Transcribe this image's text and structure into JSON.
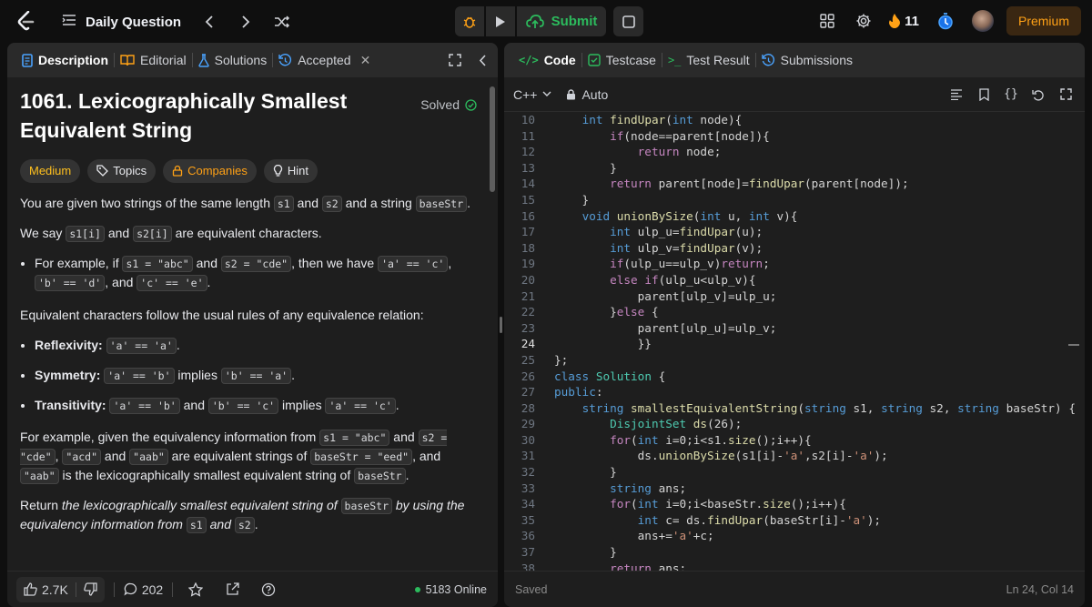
{
  "topbar": {
    "title": "Daily Question",
    "submit_label": "Submit",
    "streak": "11",
    "premium_label": "Premium"
  },
  "left_tabs": [
    "Description",
    "Editorial",
    "Solutions",
    "Accepted"
  ],
  "problem": {
    "title": "1061. Lexicographically Smallest Equivalent String",
    "solved_label": "Solved",
    "difficulty": "Medium",
    "chips": [
      "Topics",
      "Companies",
      "Hint"
    ],
    "p1a": "You are given two strings of the same length ",
    "p1_c1": "s1",
    "p1b": " and ",
    "p1_c2": "s2",
    "p1c": " and a string ",
    "p1_c3": "baseStr",
    "p1d": ".",
    "p2a": "We say ",
    "p2_c1": "s1[i]",
    "p2b": " and ",
    "p2_c2": "s2[i]",
    "p2c": " are equivalent characters.",
    "b1a": "For example, if ",
    "b1_c1": "s1 = \"abc\"",
    "b1b": " and ",
    "b1_c2": "s2 = \"cde\"",
    "b1c": ", then we have ",
    "b1_c3": "'a' == 'c'",
    "b1d": ",",
    "b1_c4": "'b' == 'd'",
    "b1e": ", and ",
    "b1_c5": "'c' == 'e'",
    "b1f": ".",
    "p3": "Equivalent characters follow the usual rules of any equivalence relation:",
    "r1_label": "Reflexivity:",
    "r1_c": "'a' == 'a'",
    "r1_end": ".",
    "r2_label": "Symmetry:",
    "r2_c1": "'a' == 'b'",
    "r2_mid": " implies ",
    "r2_c2": "'b' == 'a'",
    "r2_end": ".",
    "r3_label": "Transitivity:",
    "r3_c1": "'a' == 'b'",
    "r3_and": " and ",
    "r3_c2": "'b' == 'c'",
    "r3_mid": " implies ",
    "r3_c3": "'a' == 'c'",
    "r3_end": ".",
    "p4a": "For example, given the equivalency information from ",
    "p4_c1": "s1 = \"abc\"",
    "p4b": " and ",
    "p4_c2": "s2 = \"cde\"",
    "p4c": ", ",
    "p4_c3": "\"acd\"",
    "p4d": " and ",
    "p4_c4": "\"aab\"",
    "p4e": " are equivalent strings of ",
    "p4_c5": "baseStr = \"eed\"",
    "p4f": ", and ",
    "p4_c6": "\"aab\"",
    "p4g": " is the lexicographically smallest equivalent string of ",
    "p4_c7": "baseStr",
    "p4h": ".",
    "p5a": "Return ",
    "p5i": "the lexicographically smallest equivalent string of ",
    "p5_c1": "baseStr",
    "p5i2": " by using the equivalency information from ",
    "p5_c2": "s1",
    "p5i3": " and ",
    "p5_c3": "s2",
    "p5end": "."
  },
  "left_bottom": {
    "likes": "2.7K",
    "comments": "202",
    "online": "5183 Online"
  },
  "right_tabs": [
    "Code",
    "Testcase",
    "Test Result",
    "Submissions"
  ],
  "editor": {
    "language": "C++",
    "mode": "Auto",
    "status": "Saved",
    "cursor": "Ln 24, Col 14"
  },
  "code_lines": [
    {
      "n": "10",
      "t": "    int findUpar(int node){"
    },
    {
      "n": "11",
      "t": "        if(node==parent[node]){"
    },
    {
      "n": "12",
      "t": "            return node;"
    },
    {
      "n": "13",
      "t": "        }"
    },
    {
      "n": "14",
      "t": "        return parent[node]=findUpar(parent[node]);"
    },
    {
      "n": "15",
      "t": "    }"
    },
    {
      "n": "16",
      "t": "    void unionBySize(int u, int v){"
    },
    {
      "n": "17",
      "t": "        int ulp_u=findUpar(u);"
    },
    {
      "n": "18",
      "t": "        int ulp_v=findUpar(v);"
    },
    {
      "n": "19",
      "t": "        if(ulp_u==ulp_v)return;"
    },
    {
      "n": "20",
      "t": "        else if(ulp_u<ulp_v){"
    },
    {
      "n": "21",
      "t": "            parent[ulp_v]=ulp_u;"
    },
    {
      "n": "22",
      "t": "        }else {"
    },
    {
      "n": "23",
      "t": "            parent[ulp_u]=ulp_v;"
    },
    {
      "n": "24",
      "t": "            }}"
    },
    {
      "n": "25",
      "t": "};"
    },
    {
      "n": "26",
      "t": "class Solution {"
    },
    {
      "n": "27",
      "t": "public:"
    },
    {
      "n": "28",
      "t": "    string smallestEquivalentString(string s1, string s2, string baseStr) {"
    },
    {
      "n": "29",
      "t": "        DisjointSet ds(26);"
    },
    {
      "n": "30",
      "t": "        for(int i=0;i<s1.size();i++){"
    },
    {
      "n": "31",
      "t": "            ds.unionBySize(s1[i]-'a',s2[i]-'a');"
    },
    {
      "n": "32",
      "t": "        }"
    },
    {
      "n": "33",
      "t": "        string ans;"
    },
    {
      "n": "34",
      "t": "        for(int i=0;i<baseStr.size();i++){"
    },
    {
      "n": "35",
      "t": "            int c= ds.findUpar(baseStr[i]-'a');"
    },
    {
      "n": "36",
      "t": "            ans+='a'+c;"
    },
    {
      "n": "37",
      "t": "        }"
    },
    {
      "n": "38",
      "t": "        return ans;"
    }
  ]
}
